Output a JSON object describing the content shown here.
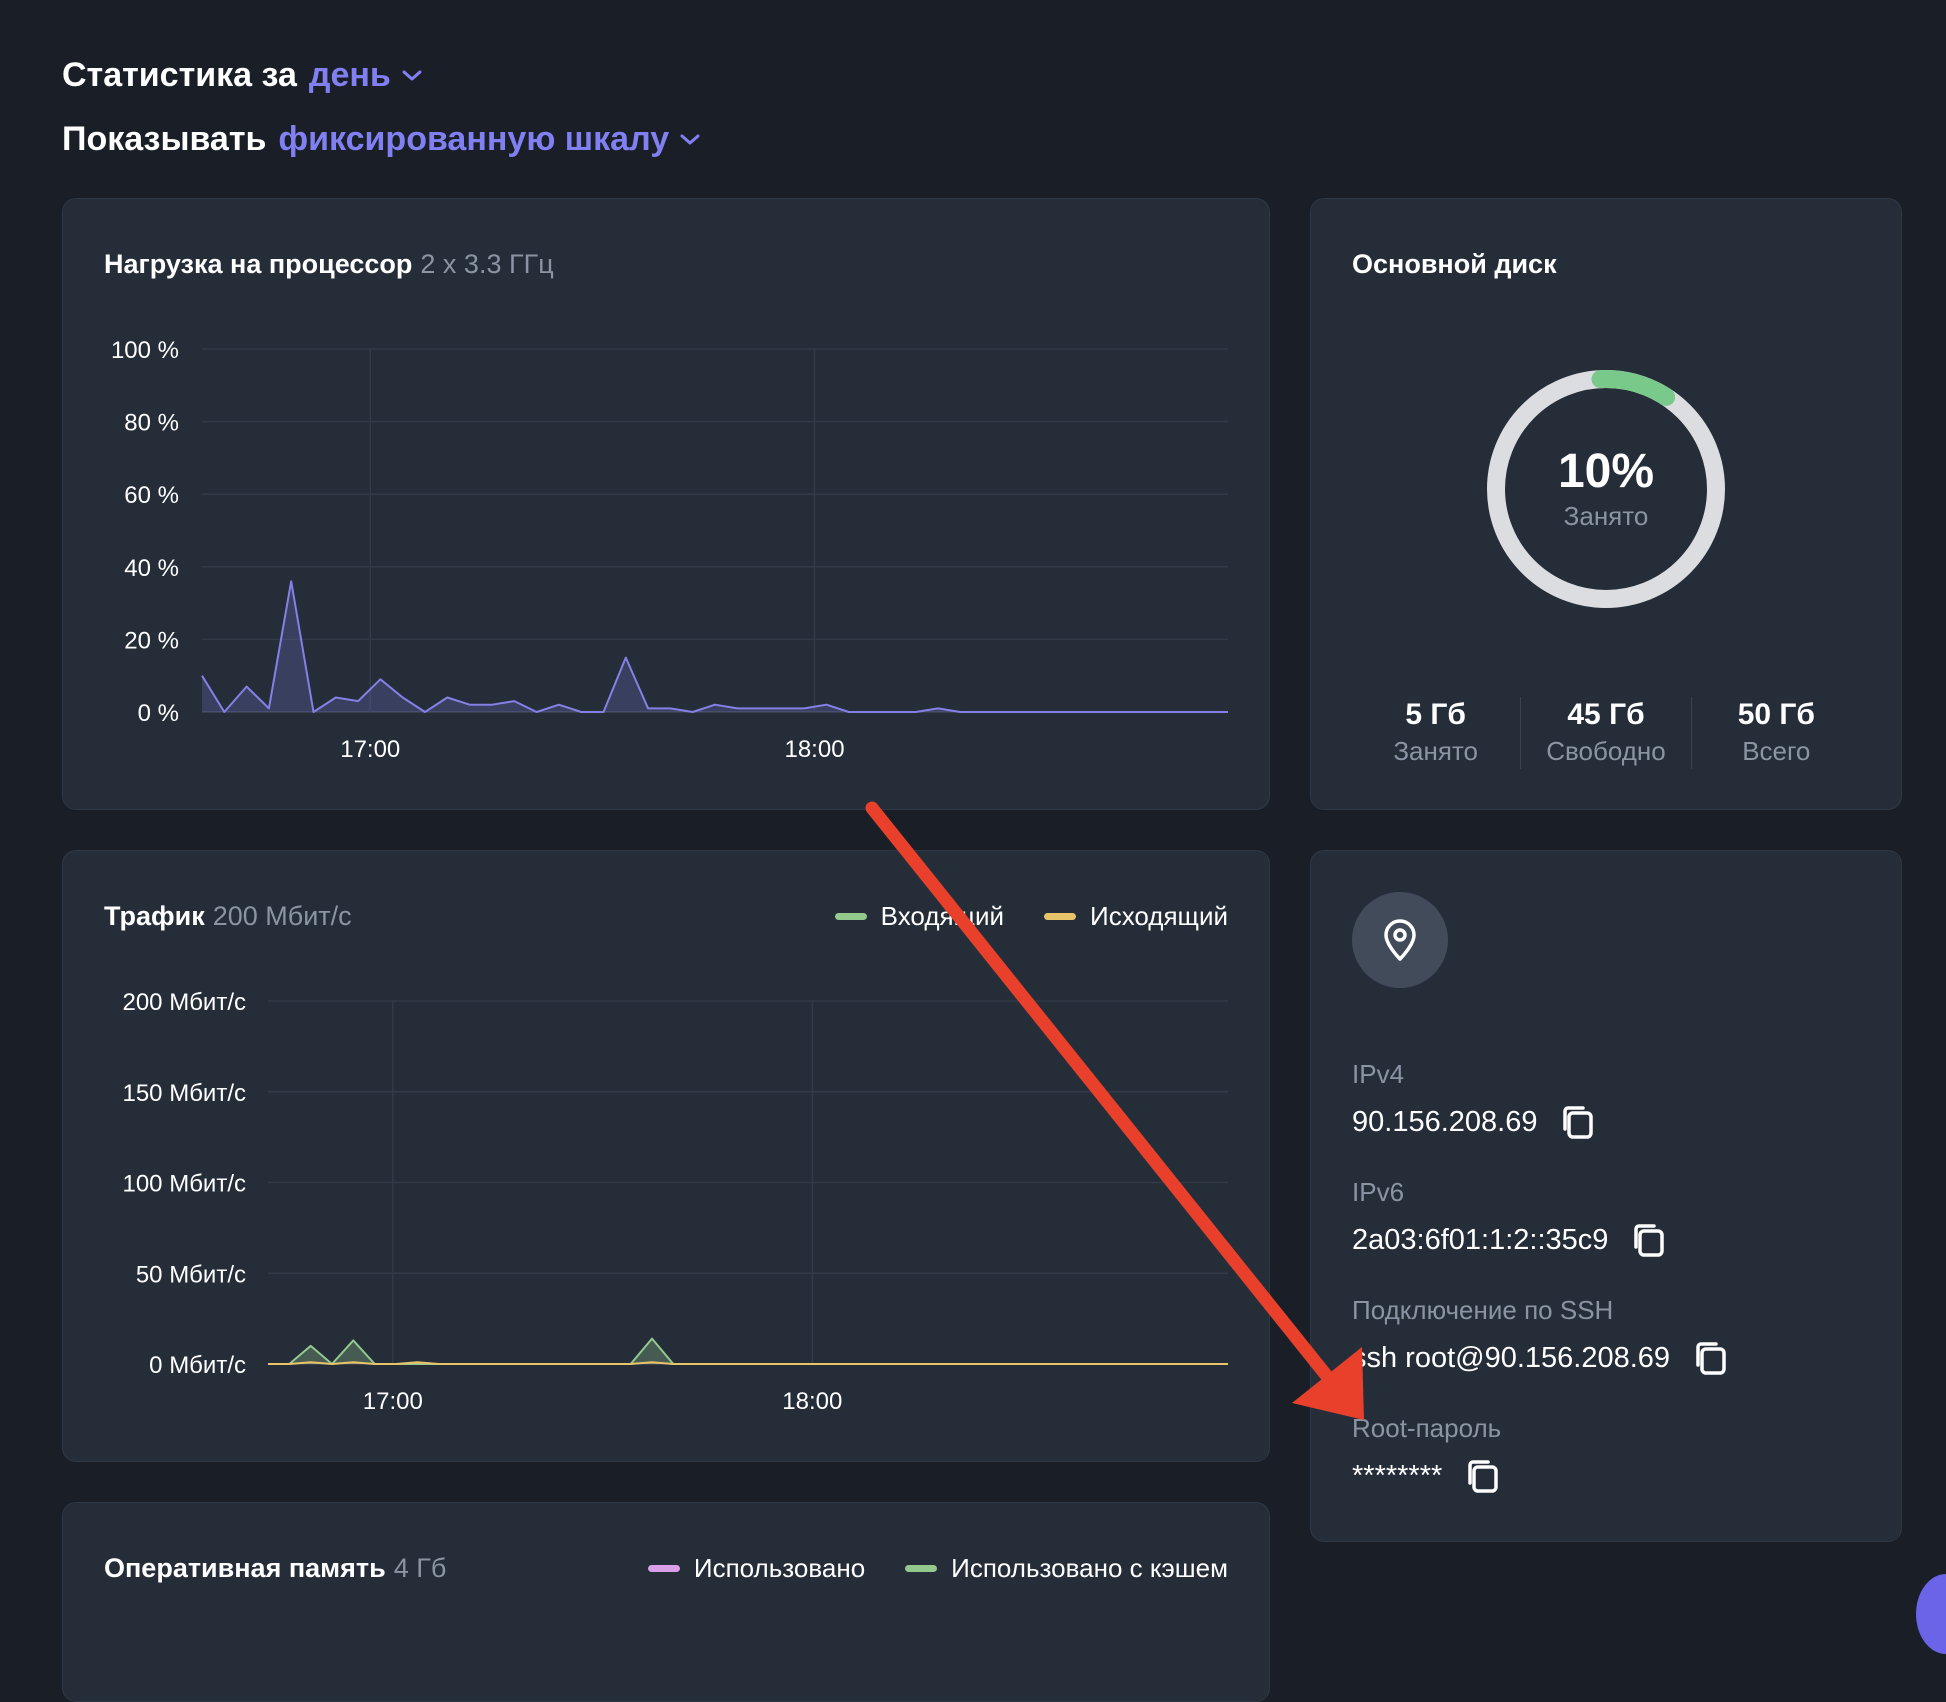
{
  "header": {
    "stats_label": "Статистика за",
    "stats_period": "день",
    "show_label": "Показывать",
    "show_mode": "фиксированную шкалу"
  },
  "cpu": {
    "title": "Нагрузка на процессор",
    "spec": "2 x 3.3 ГГц",
    "chart_data": {
      "type": "area",
      "y_ticks": [
        "100 %",
        "80 %",
        "60 %",
        "40 %",
        "20 %",
        "0 %"
      ],
      "x_ticks": [
        "17:00",
        "18:00"
      ],
      "ylim": [
        0,
        100
      ],
      "grid": true,
      "series": [
        {
          "color": "#8481e6",
          "values": [
            10,
            0,
            7,
            1,
            36,
            0,
            4,
            3,
            9,
            4,
            0,
            4,
            2,
            2,
            3,
            0,
            2,
            0,
            0,
            15,
            1,
            1,
            0,
            2,
            1,
            1,
            1,
            1,
            2,
            0,
            0,
            0,
            0,
            1,
            0,
            0,
            0,
            0,
            0,
            0,
            0,
            0,
            0,
            0,
            0,
            0,
            0
          ]
        }
      ]
    }
  },
  "traffic": {
    "title": "Трафик",
    "spec": "200 Мбит/с",
    "legend": [
      {
        "label": "Входящий",
        "color": "#94c98e"
      },
      {
        "label": "Исходящий",
        "color": "#e7c46a"
      }
    ],
    "chart_data": {
      "type": "area",
      "y_ticks": [
        "200 Мбит/с",
        "150 Мбит/с",
        "100 Мбит/с",
        "50 Мбит/с",
        "0 Мбит/с"
      ],
      "x_ticks": [
        "17:00",
        "18:00"
      ],
      "ylim": [
        0,
        200
      ],
      "grid": true,
      "series": [
        {
          "color": "#94c98e",
          "values": [
            0,
            0,
            10,
            0,
            13,
            0,
            0,
            0,
            0,
            0,
            0,
            0,
            0,
            0,
            0,
            0,
            0,
            0,
            14,
            0,
            0,
            0,
            0,
            0,
            0,
            0,
            0,
            0,
            0,
            0,
            0,
            0,
            0,
            0,
            0,
            0,
            0,
            0,
            0,
            0,
            0,
            0,
            0,
            0,
            0,
            0
          ]
        },
        {
          "color": "#e7c46a",
          "values": [
            0,
            0,
            1,
            0,
            1,
            0,
            0,
            1,
            0,
            0,
            0,
            0,
            0,
            0,
            0,
            0,
            0,
            0,
            1,
            0,
            0,
            0,
            0,
            0,
            0,
            0,
            0,
            0,
            0,
            0,
            0,
            0,
            0,
            0,
            0,
            0,
            0,
            0,
            0,
            0,
            0,
            0,
            0,
            0,
            0,
            0
          ]
        }
      ]
    }
  },
  "ram": {
    "title": "Оперативная память",
    "spec": "4 Гб",
    "legend": [
      {
        "label": "Использовано",
        "color": "#d9a0e8"
      },
      {
        "label": "Использовано с кэшем",
        "color": "#94c98e"
      }
    ]
  },
  "disk": {
    "title": "Основной диск",
    "percent": "10%",
    "percent_value": 10,
    "percent_label": "Занято",
    "used_value": "5 Гб",
    "used_label": "Занято",
    "free_value": "45 Гб",
    "free_label": "Свободно",
    "total_value": "50 Гб",
    "total_label": "Всего",
    "ring_color": "#dcdde0",
    "used_color": "#79c98a"
  },
  "server": {
    "location_icon": "location-pin-icon",
    "ipv4_label": "IPv4",
    "ipv4": "90.156.208.69",
    "ipv6_label": "IPv6",
    "ipv6": "2a03:6f01:1:2::35c9",
    "ssh_label": "Подключение по SSH",
    "ssh": "ssh root@90.156.208.69",
    "root_label": "Root-пароль",
    "root": "********"
  },
  "colors": {
    "background": "#1a1f27",
    "card": "#252d39",
    "accent": "#8180f2",
    "annotation_arrow": "#e8402a"
  }
}
